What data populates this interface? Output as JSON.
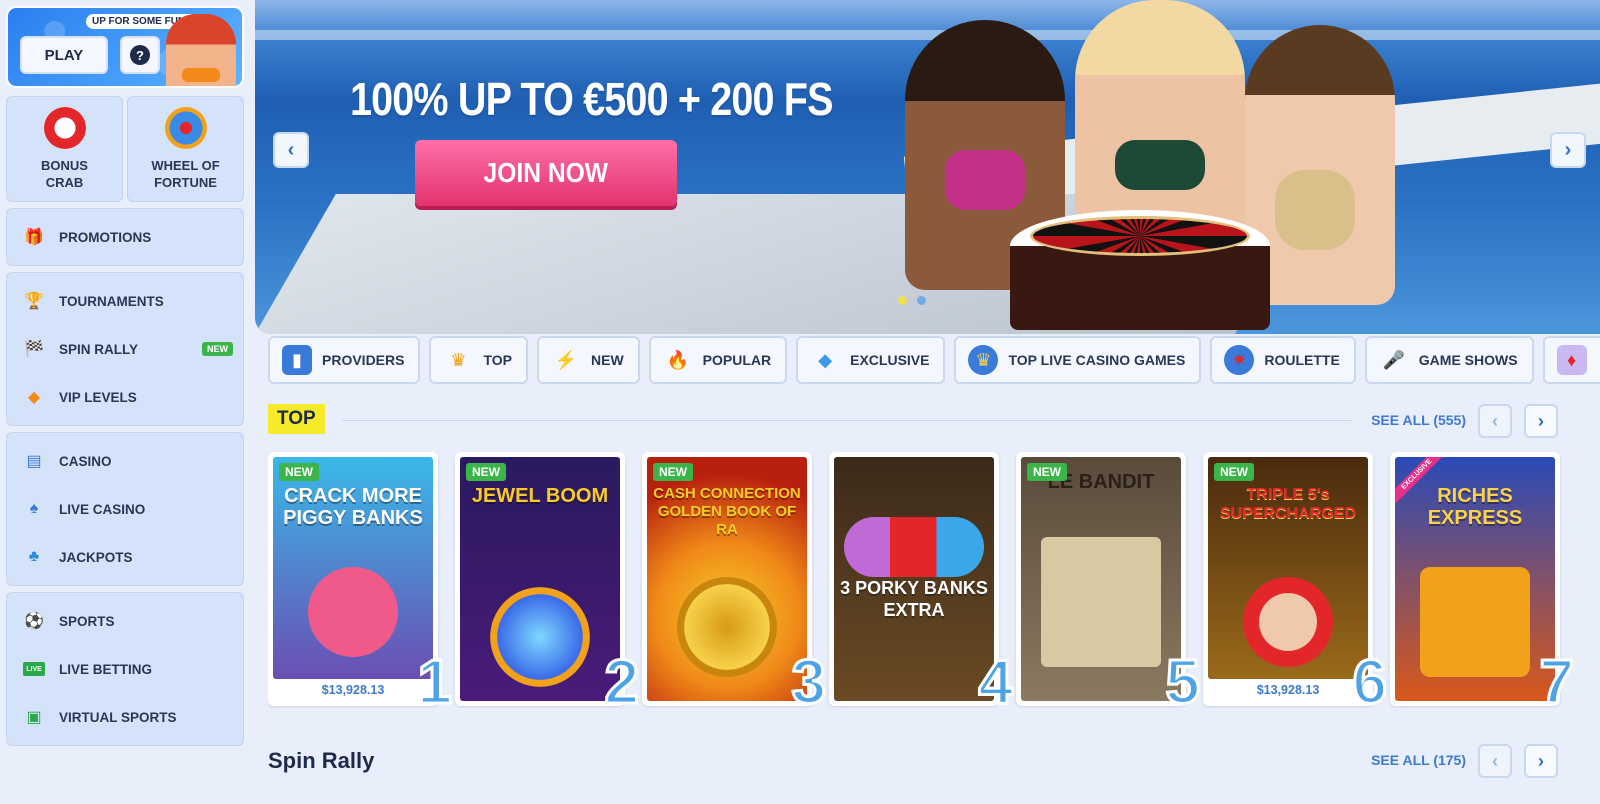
{
  "sidebar": {
    "promo_tag": "UP FOR SOME FUN?",
    "play_label": "PLAY",
    "help_label": "?",
    "quick": [
      {
        "label": "BONUS\nCRAB",
        "icon": "crab-claw-icon"
      },
      {
        "label": "WHEEL OF\nFORTUNE",
        "icon": "wheel-icon"
      }
    ],
    "groups": [
      [
        {
          "label": "PROMOTIONS",
          "icon": "gift-icon"
        }
      ],
      [
        {
          "label": "TOURNAMENTS",
          "icon": "trophy-icon"
        },
        {
          "label": "SPIN RALLY",
          "icon": "checkered-flag-icon",
          "badge": "NEW"
        },
        {
          "label": "VIP LEVELS",
          "icon": "diamond-icon"
        }
      ],
      [
        {
          "label": "CASINO",
          "icon": "slot-machine-icon"
        },
        {
          "label": "LIVE CASINO",
          "icon": "playing-card-icon"
        },
        {
          "label": "JACKPOTS",
          "icon": "clover-icon"
        }
      ],
      [
        {
          "label": "SPORTS",
          "icon": "soccer-ball-icon"
        },
        {
          "label": "LIVE BETTING",
          "icon": "live-icon"
        },
        {
          "label": "VIRTUAL SPORTS",
          "icon": "monitor-icon"
        }
      ]
    ],
    "live_icon_text": "LIVE"
  },
  "hero": {
    "title": "100% UP TO €500 + 200 FS",
    "cta": "JOIN NOW",
    "prev": "‹",
    "next": "›",
    "slides": 2,
    "active_slide": 1
  },
  "categories": [
    {
      "label": "PROVIDERS",
      "icon": "book-icon"
    },
    {
      "label": "TOP",
      "icon": "crown-icon"
    },
    {
      "label": "NEW",
      "icon": "lightning-icon"
    },
    {
      "label": "POPULAR",
      "icon": "fire-icon"
    },
    {
      "label": "EXCLUSIVE",
      "icon": "gem-icon"
    },
    {
      "label": "TOP LIVE CASINO GAMES",
      "icon": "chip-crown-icon"
    },
    {
      "label": "ROULETTE",
      "icon": "roulette-icon"
    },
    {
      "label": "GAME SHOWS",
      "icon": "microphone-icon"
    },
    {
      "label": "",
      "icon": "cards-icon"
    }
  ],
  "top_section": {
    "title": "TOP",
    "see_all": "SEE ALL (555)",
    "prev": "‹",
    "next": "›"
  },
  "games": [
    {
      "title": "CRACK MORE PIGGY BANKS",
      "rank": "1",
      "tag": "NEW",
      "jackpot": "$13,928.13",
      "bg1": "#39b8e8",
      "bg2": "#6b4fb3",
      "accent": "#f05a8a"
    },
    {
      "title": "JEWEL BOOM",
      "rank": "2",
      "tag": "NEW",
      "jackpot": "",
      "bg1": "#2a1a5e",
      "bg2": "#4a1b7a",
      "accent": "#7fd8ff"
    },
    {
      "title": "CASH CONNECTION GOLDEN BOOK OF RA",
      "rank": "3",
      "tag": "NEW",
      "jackpot": "",
      "bg1": "#b8200e",
      "bg2": "#f08a18",
      "accent": "#f7cc2a"
    },
    {
      "title": "3 PORKY BANKS EXTRA",
      "rank": "4",
      "tag": "",
      "jackpot": "",
      "bg1": "#3a2a1a",
      "bg2": "#6b4a24",
      "accent": "#e94a7a"
    },
    {
      "title": "LE BANDIT",
      "rank": "5",
      "tag": "NEW",
      "jackpot": "",
      "bg1": "#5a4a3a",
      "bg2": "#8a7a62",
      "accent": "#d9c9a2"
    },
    {
      "title": "TRIPLE 5's SUPERCHARGED",
      "rank": "6",
      "tag": "NEW",
      "jackpot": "$13,928.13",
      "bg1": "#4a2a0e",
      "bg2": "#9a6a1a",
      "accent": "#e3262a"
    },
    {
      "title": "RICHES EXPRESS",
      "rank": "7",
      "tag": "EXCLUSIVE",
      "jackpot": "",
      "bg1": "#2a4ab8",
      "bg2": "#f2a21a",
      "accent": "#f7d24a"
    }
  ],
  "spin_section": {
    "title": "Spin Rally",
    "see_all": "SEE ALL (175)",
    "prev": "‹",
    "next": "›"
  }
}
